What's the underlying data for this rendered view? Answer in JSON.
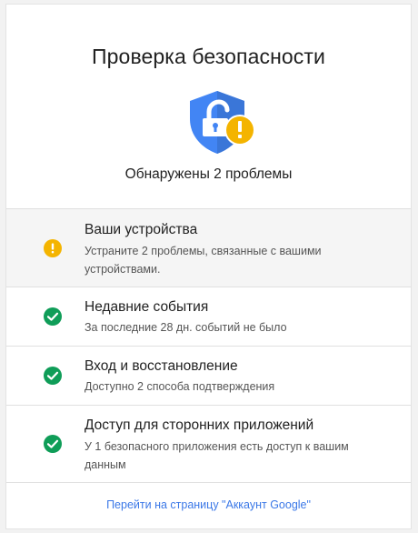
{
  "page": {
    "title": "Проверка безопасности",
    "summary": "Обнаружены 2 проблемы"
  },
  "header_icon": "shield-unlocked-warning-icon",
  "items": [
    {
      "title": "Ваши устройства",
      "description": "Устраните 2 проблемы, связанные с вашими устройствами.",
      "status": "warning",
      "status_icon": "warning-icon"
    },
    {
      "title": "Недавние события",
      "description": "За последние 28 дн. событий не было",
      "status": "ok",
      "status_icon": "check-circle-icon"
    },
    {
      "title": "Вход и восстановление",
      "description": "Доступно 2 способа подтверждения",
      "status": "ok",
      "status_icon": "check-circle-icon"
    },
    {
      "title": "Доступ для сторонних приложений",
      "description": "У 1 безопасного приложения есть доступ к вашим данным",
      "status": "ok",
      "status_icon": "check-circle-icon"
    }
  ],
  "footer": {
    "link_label": "Перейти на страницу \"Аккаунт Google\""
  },
  "colors": {
    "warning": "#f4b400",
    "ok": "#0f9d58",
    "shield": "#4285f4",
    "link": "#3b78e7"
  }
}
